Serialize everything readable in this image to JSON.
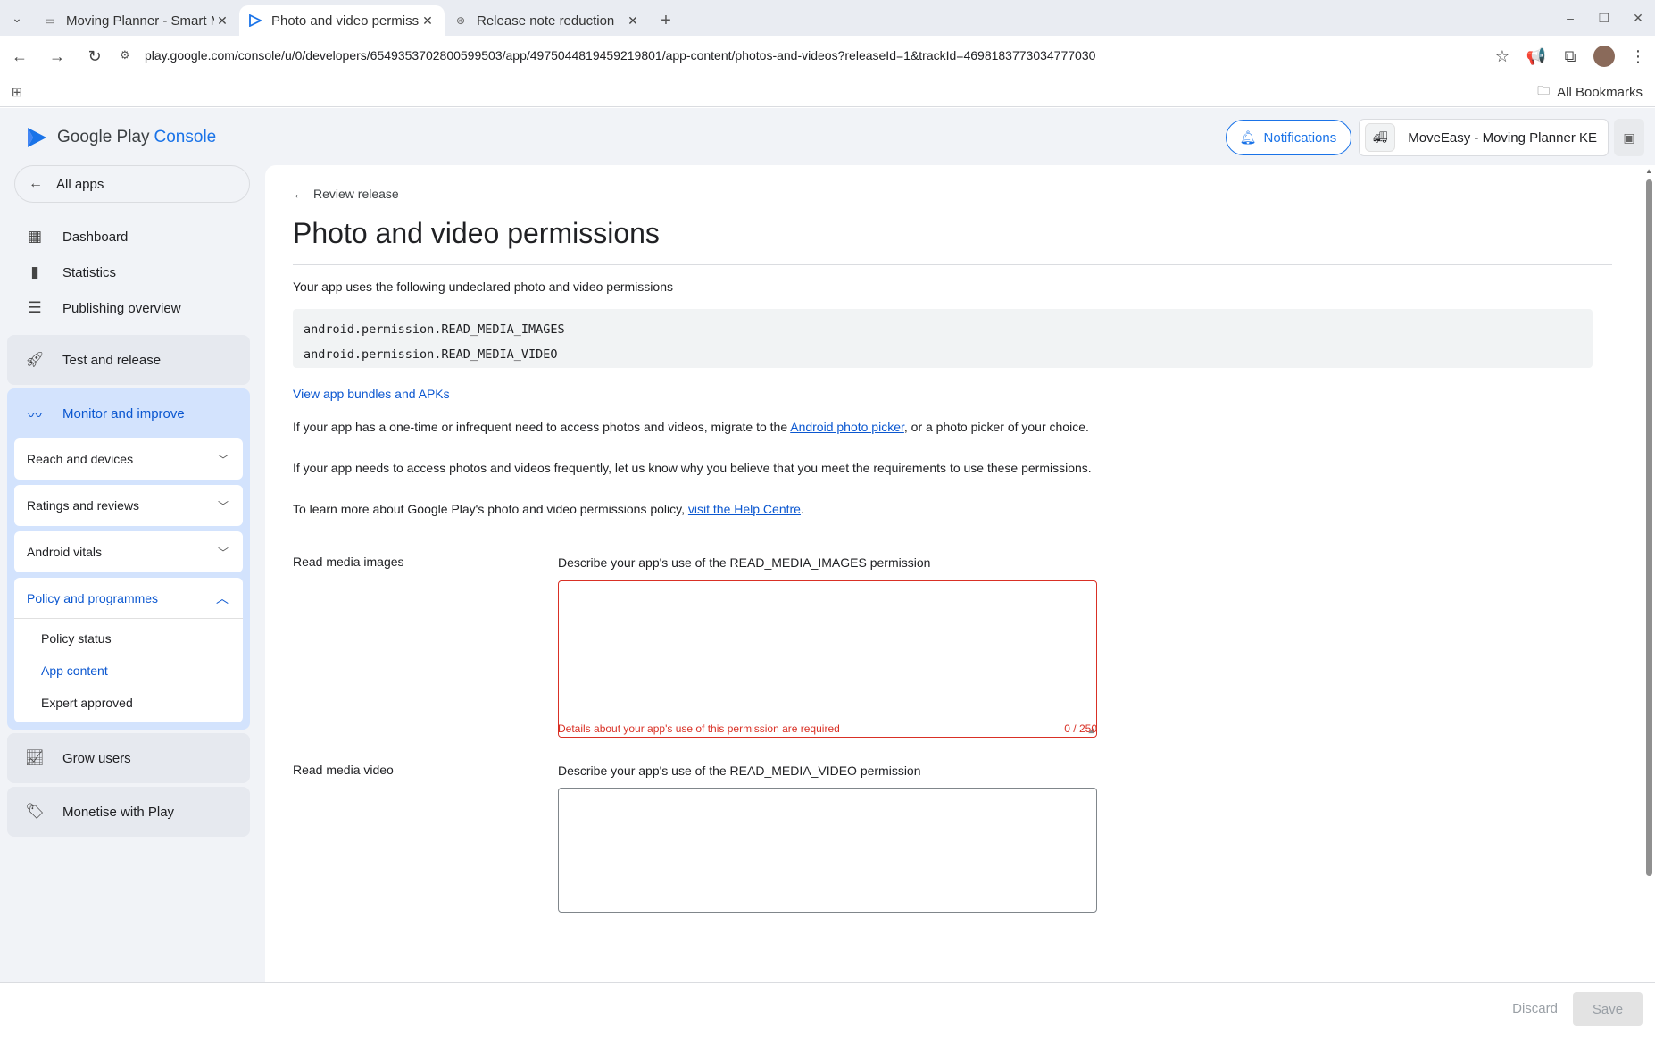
{
  "browser": {
    "tabs": [
      {
        "title": "Moving Planner - Smart M",
        "icon": "moving-app-favicon"
      },
      {
        "title": "Photo and video permiss",
        "icon": "play-console-favicon"
      },
      {
        "title": "Release note reduction",
        "icon": "chatgpt-favicon"
      }
    ],
    "url": "play.google.com/console/u/0/developers/6549353702800599503/app/4975044819459219801/app-content/photos-and-videos?releaseId=1&trackId=4698183773034777030",
    "bookmarks_label": "All Bookmarks"
  },
  "header": {
    "brand_google_play": "Google Play",
    "brand_console": "Console",
    "notifications_label": "Notifications",
    "app_name": "MoveEasy - Moving Planner KE"
  },
  "sidebar": {
    "all_apps": "All apps",
    "items": [
      {
        "label": "Dashboard",
        "icon": "dashboard-icon"
      },
      {
        "label": "Statistics",
        "icon": "bar-chart-icon"
      },
      {
        "label": "Publishing overview",
        "icon": "publishing-overview-icon"
      }
    ],
    "test_release": "Test and release",
    "monitor": {
      "label": "Monitor and improve",
      "subs": [
        "Reach and devices",
        "Ratings and reviews",
        "Android vitals"
      ],
      "policy": {
        "label": "Policy and programmes",
        "items": [
          "Policy status",
          "App content",
          "Expert approved"
        ],
        "active": "App content"
      }
    },
    "grow_users": "Grow users",
    "monetise": "Monetise with Play"
  },
  "main": {
    "back_label": "Review release",
    "title": "Photo and video permissions",
    "intro": "Your app uses the following undeclared photo and video permissions",
    "permissions": [
      "android.permission.READ_MEDIA_IMAGES",
      "android.permission.READ_MEDIA_VIDEO"
    ],
    "view_bundles": "View app bundles and APKs",
    "para1_before": "If your app has a one-time or infrequent need to access photos and videos, migrate to the ",
    "para1_link": "Android photo picker",
    "para1_after": ", or a photo picker of your choice.",
    "para2": "If your app needs to access photos and videos frequently, let us know why you believe that you meet the requirements to use these permissions.",
    "para3_before": "To learn more about Google Play's photo and video permissions policy, ",
    "para3_link": "visit the Help Centre",
    "para3_after": ".",
    "fields": [
      {
        "label": "Read media images",
        "description": "Describe your app's use of the READ_MEDIA_IMAGES permission",
        "value": "",
        "error": "Details about your app's use of this permission are required",
        "counter": "0 / 250"
      },
      {
        "label": "Read media video",
        "description": "Describe your app's use of the READ_MEDIA_VIDEO permission",
        "value": ""
      }
    ]
  },
  "footer": {
    "discard": "Discard",
    "save": "Save"
  },
  "colors": {
    "accent": "#0b57d0",
    "error": "#d93025",
    "nav_active_bg": "#d3e3fd"
  }
}
